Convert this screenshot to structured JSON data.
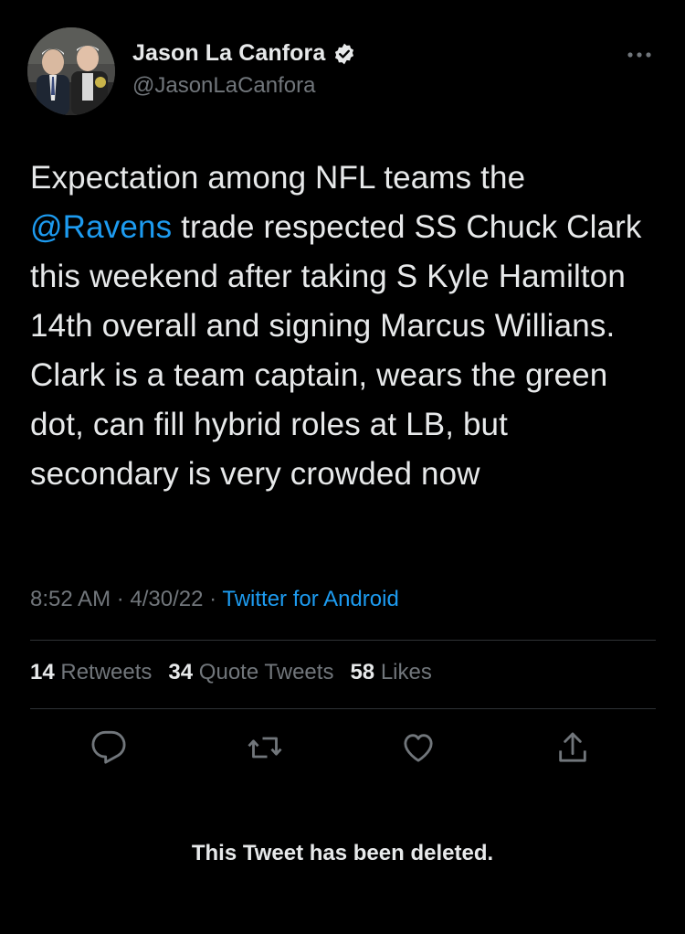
{
  "author": {
    "display_name": "Jason La Canfora",
    "handle": "@JasonLaCanfora",
    "verified": true
  },
  "tweet": {
    "text_before": "Expectation among NFL teams the ",
    "mention": "@Ravens",
    "text_after": " trade respected SS Chuck Clark this weekend after taking S Kyle Hamilton 14th overall and signing Marcus Willians. Clark is a team captain, wears the green dot, can fill hybrid roles at LB, but secondary is very crowded now"
  },
  "meta": {
    "time": "8:52 AM",
    "date": "4/30/22",
    "separator": " · ",
    "source": "Twitter for Android"
  },
  "stats": {
    "retweets_count": "14",
    "retweets_label": "Retweets",
    "quotes_count": "34",
    "quotes_label": "Quote Tweets",
    "likes_count": "58",
    "likes_label": "Likes"
  },
  "actions": {
    "icons": [
      "reply-icon",
      "retweet-icon",
      "like-icon",
      "share-icon"
    ]
  },
  "notice": {
    "deleted_text": "This Tweet has been deleted."
  },
  "colors": {
    "background": "#000000",
    "text_primary": "#e7e9ea",
    "text_secondary": "#71767b",
    "accent": "#1d9bf0",
    "divider": "#2f3336"
  }
}
